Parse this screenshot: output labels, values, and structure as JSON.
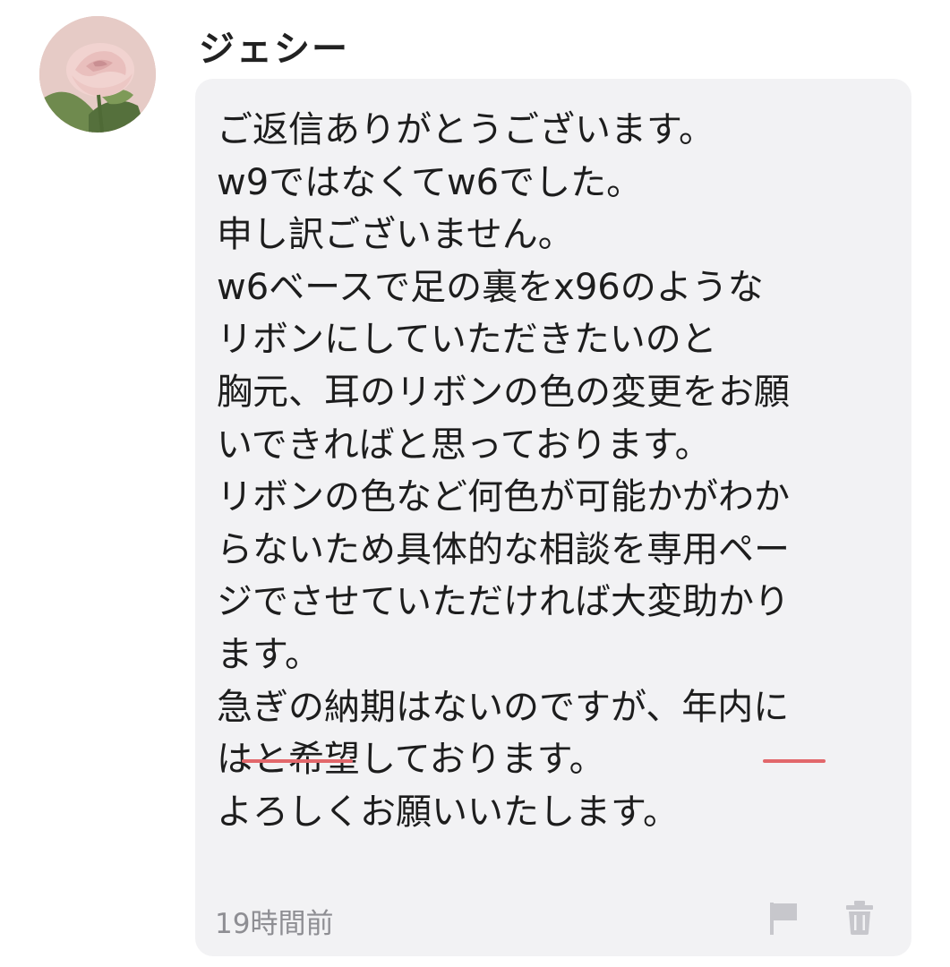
{
  "comment": {
    "author": "ジェシー",
    "avatar_icon": "rose-avatar",
    "lines": [
      "ご返信ありがとうございます。",
      "w9ではなくてw6でした。",
      "申し訳ございません。",
      "w6ベースで足の裏をx96のような",
      "リボンにしていただきたいのと",
      "胸元、耳のリボンの色の変更をお願",
      "いできればと思っております。",
      "リボンの色など何色が可能かがわか",
      "らないため具体的な相談を専用ペー",
      "ジでさせていただければ大変助かり",
      "ます。",
      "急ぎの納期はないのですが、年内に",
      "はと希望しております。",
      "よろしくお願いいたします。"
    ],
    "timestamp": "19時間前",
    "actions": {
      "report_icon": "flag-icon",
      "delete_icon": "trash-icon"
    },
    "highlight_color": "#e2676b"
  }
}
